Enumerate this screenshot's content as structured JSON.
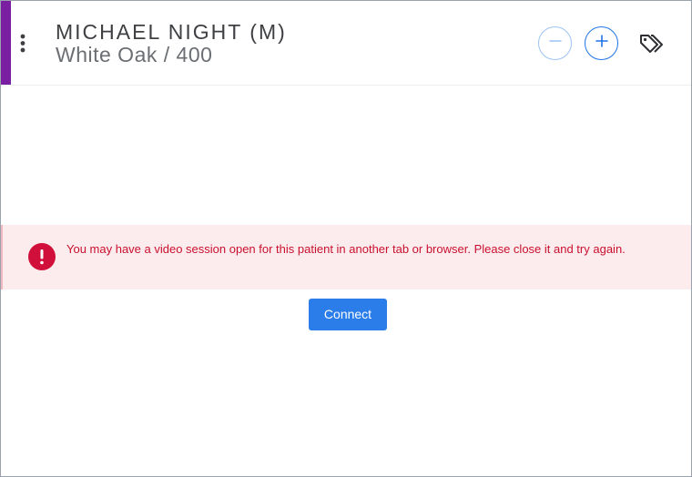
{
  "header": {
    "patient_name": "MICHAEL NIGHT (M)",
    "location": "White Oak / 400",
    "accent_color": "#7b1fa2",
    "menu_icon": "more-vertical-icon",
    "zoom_out_icon": "minus-icon",
    "zoom_in_icon": "plus-icon",
    "tags_icon": "tags-icon"
  },
  "alert": {
    "icon": "error-icon",
    "message": "You may have a video session open for this patient in another tab or browser. Please close it and try again.",
    "color": "#c8102e"
  },
  "actions": {
    "connect_label": "Connect",
    "connect_color": "#2b7de9"
  }
}
